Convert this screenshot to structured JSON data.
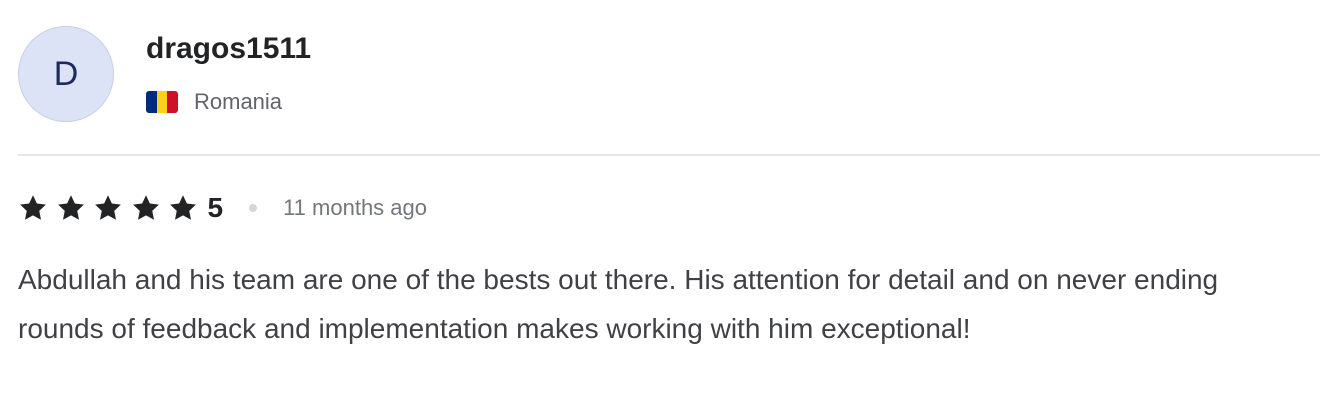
{
  "reviewer": {
    "avatar_letter": "D",
    "username": "dragos1511",
    "country": "Romania",
    "flag": {
      "name": "romania-flag",
      "colors": [
        "#002B7F",
        "#FCD116",
        "#CE1126"
      ]
    }
  },
  "rating": {
    "stars": 5,
    "value": "5",
    "star_icon": "star-icon",
    "star_color": "#222325"
  },
  "time_ago": "11 months ago",
  "review_text": "Abdullah and his team are one of the bests out there. His attention for detail and on never ending rounds of feedback and implementation makes working with him exceptional!"
}
